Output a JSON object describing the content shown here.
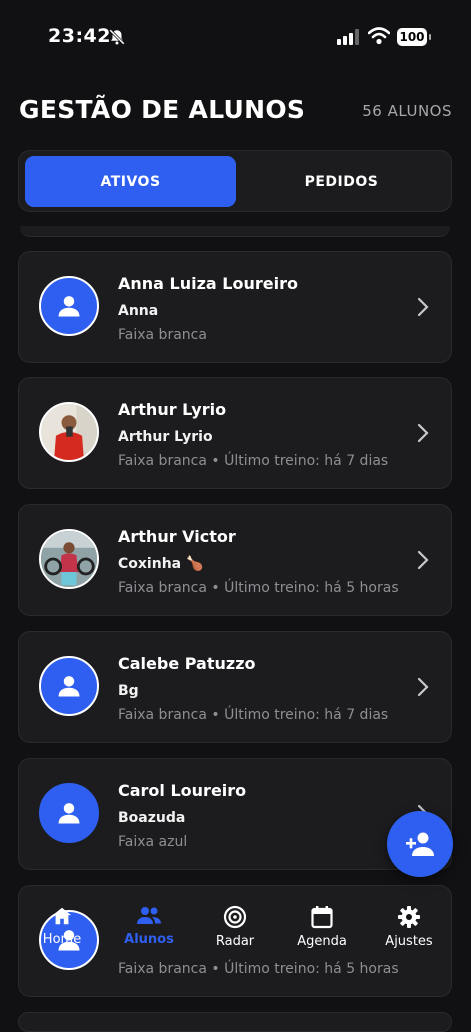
{
  "status_bar": {
    "time": "23:42",
    "battery": "100"
  },
  "header": {
    "title": "GESTÃO DE ALUNOS",
    "count": "56 ALUNOS"
  },
  "segments": {
    "active": "ATIVOS",
    "inactive": "PEDIDOS"
  },
  "students": [
    {
      "name": "Anna Luiza Loureiro",
      "nickname": "Anna",
      "meta": "Faixa branca",
      "avatar": "default"
    },
    {
      "name": "Arthur Lyrio",
      "nickname": "Arthur Lyrio",
      "meta": "Faixa branca • Último treino: há 7 dias",
      "avatar": "photo"
    },
    {
      "name": "Arthur Victor",
      "nickname": "Coxinha 🍗",
      "meta": "Faixa branca • Último treino: há 5 horas",
      "avatar": "photo"
    },
    {
      "name": "Calebe Patuzzo",
      "nickname": "Bg",
      "meta": "Faixa branca • Último treino: há 7 dias",
      "avatar": "default"
    },
    {
      "name": "Carol Loureiro",
      "nickname": "Boazuda",
      "meta": "Faixa azul",
      "avatar": "default"
    },
    {
      "name": "",
      "nickname": "",
      "meta": "Faixa branca • Último treino: há 5 horas",
      "avatar": "default"
    }
  ],
  "tabs": [
    {
      "label": "Home",
      "icon": "home-icon",
      "active": false
    },
    {
      "label": "Alunos",
      "icon": "users-icon",
      "active": true
    },
    {
      "label": "Radar",
      "icon": "radar-icon",
      "active": false
    },
    {
      "label": "Agenda",
      "icon": "calendar-icon",
      "active": false
    },
    {
      "label": "Ajustes",
      "icon": "gear-icon",
      "active": false
    }
  ],
  "colors": {
    "accent": "#2f5ff0",
    "background": "#111113",
    "card": "#1c1c1f",
    "muted_text": "#8e8e93"
  }
}
